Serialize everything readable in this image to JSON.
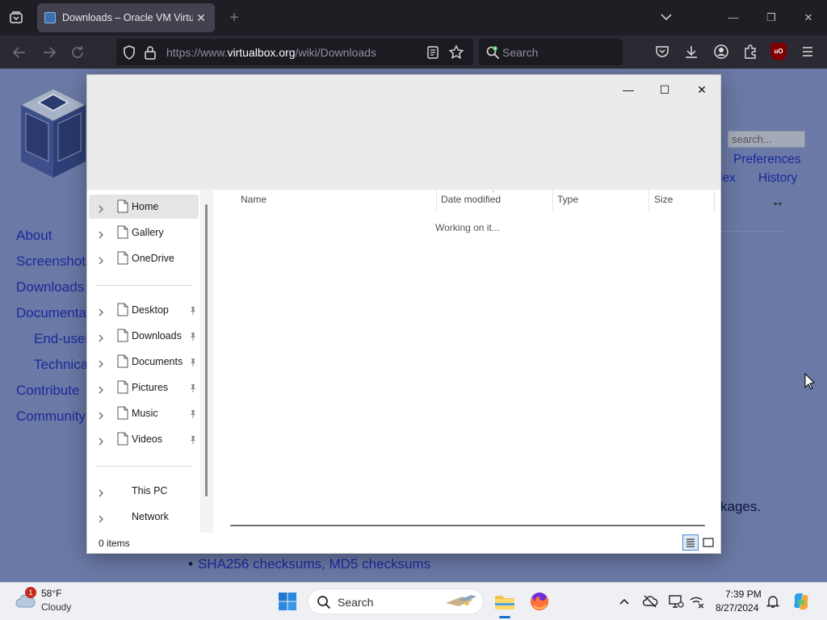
{
  "browser": {
    "tab_title": "Downloads – Oracle VM VirtualBox",
    "url_dim": "https://www.",
    "url_domain": "virtualbox.org",
    "url_path": "/wiki/Downloads",
    "search_placeholder": "Search",
    "ublock_label": "uO",
    "icons": [
      "tab-list-icon",
      "close-icon",
      "plus-icon",
      "chevron-down-icon",
      "minimize-icon",
      "restore-icon",
      "back-icon",
      "forward-icon",
      "reload-icon",
      "shield-icon",
      "lock-icon",
      "reader-view-icon",
      "star-icon",
      "pocket-icon",
      "download-icon",
      "account-icon",
      "extensions-icon",
      "menu-icon"
    ]
  },
  "webpage": {
    "search_placeholder": "search...",
    "top_links": {
      "preferences": "Preferences",
      "index_partial": "lex",
      "history": "History"
    },
    "resize_glyph": "↔",
    "sidebar": [
      {
        "label": "About",
        "sub": false
      },
      {
        "label": "Screenshots",
        "sub": false
      },
      {
        "label": "Downloads",
        "sub": false
      },
      {
        "label": "Documentation",
        "sub": false
      },
      {
        "label": "End-user docs",
        "sub": true
      },
      {
        "label": "Technical docs",
        "sub": true
      },
      {
        "label": "Contribute",
        "sub": false
      },
      {
        "label": "Community",
        "sub": false
      }
    ],
    "body_fragment": "kages.",
    "bullet_link": "SHA256 checksums, MD5 checksums"
  },
  "dialog": {
    "controls": {
      "minimize": "—",
      "maximize": "☐",
      "close": "✕"
    },
    "nav_groups": [
      [
        {
          "label": "Home",
          "pinned": false,
          "selected": true
        },
        {
          "label": "Gallery",
          "pinned": false,
          "selected": false
        },
        {
          "label": "OneDrive",
          "pinned": false,
          "selected": false
        }
      ],
      [
        {
          "label": "Desktop",
          "pinned": true,
          "selected": false
        },
        {
          "label": "Downloads",
          "pinned": true,
          "selected": false
        },
        {
          "label": "Documents",
          "pinned": true,
          "selected": false
        },
        {
          "label": "Pictures",
          "pinned": true,
          "selected": false
        },
        {
          "label": "Music",
          "pinned": true,
          "selected": false
        },
        {
          "label": "Videos",
          "pinned": true,
          "selected": false
        }
      ],
      [
        {
          "label": "This PC",
          "pinned": false,
          "selected": false
        },
        {
          "label": "Network",
          "pinned": false,
          "selected": false
        }
      ]
    ],
    "columns": [
      "Name",
      "Date modified",
      "Type",
      "Size"
    ],
    "loading_text": "Working on it...",
    "status_text": "0 items",
    "view_buttons": [
      "details-view-icon",
      "large-icons-view-icon"
    ]
  },
  "taskbar": {
    "weather": {
      "temp": "58°F",
      "condition": "Cloudy",
      "badge": "1"
    },
    "search_placeholder": "Search",
    "apps": [
      "file-explorer-icon",
      "firefox-icon"
    ],
    "tray_icons": [
      "chevron-up-icon",
      "onedrive-offline-icon",
      "display-icon",
      "network-icon",
      "bell-icon"
    ],
    "time": "7:39 PM",
    "date": "8/27/2024"
  }
}
